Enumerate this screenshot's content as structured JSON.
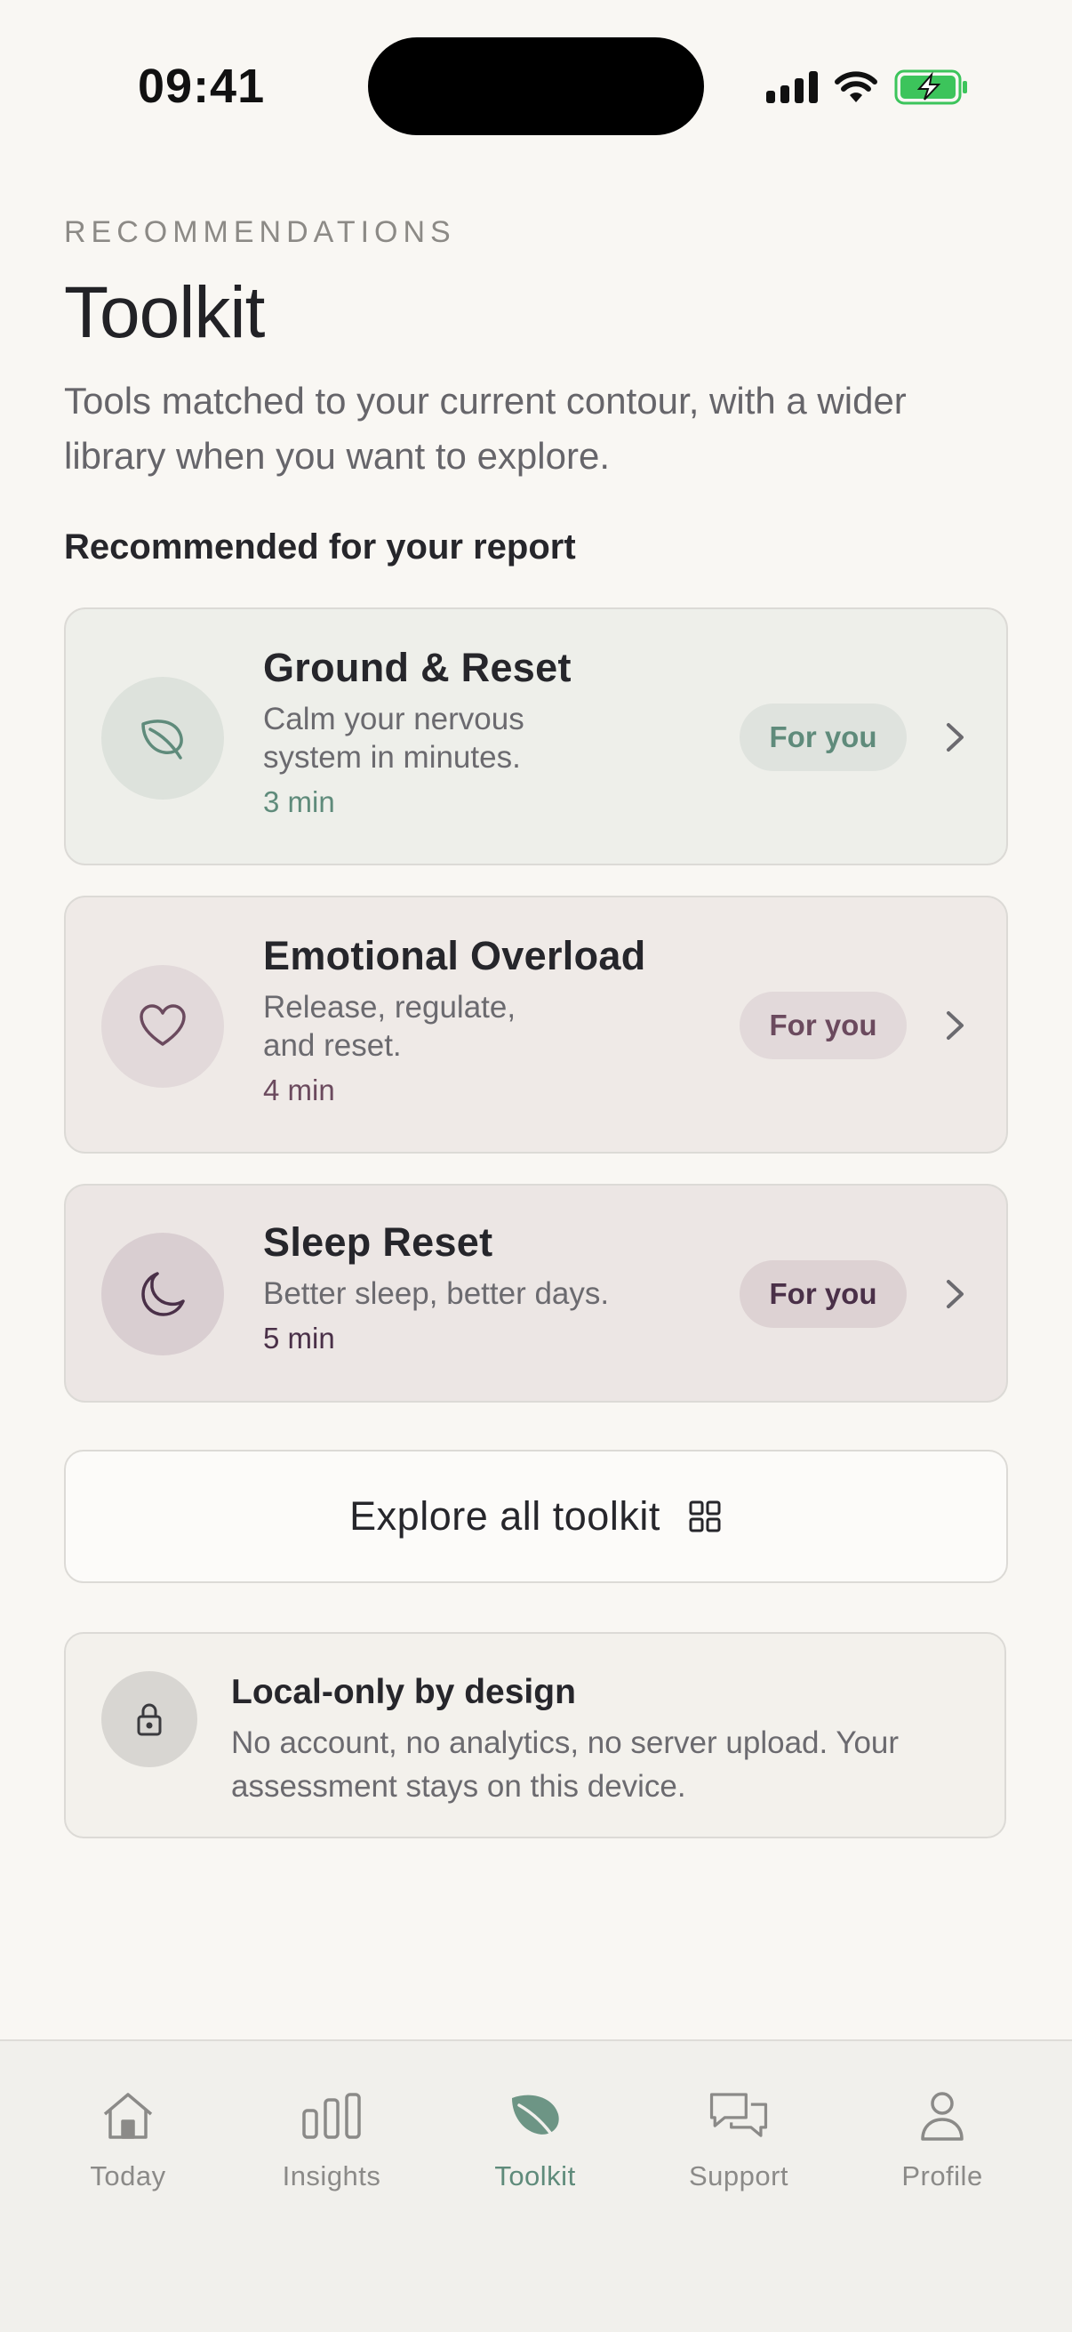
{
  "status_bar": {
    "time": "09:41"
  },
  "header": {
    "eyebrow": "RECOMMENDATIONS",
    "title": "Toolkit",
    "subtitle": "Tools matched to your current contour, with a wider library when you want to explore."
  },
  "section_title": "Recommended for your report",
  "recommendations": [
    {
      "name": "Ground & Reset",
      "description": "Calm your nervous system in minutes.",
      "duration": "3 min",
      "badge": "For you",
      "icon": "leaf-icon",
      "accent": "#5f8b7b"
    },
    {
      "name": "Emotional Overload",
      "description": "Release, regulate, and reset.",
      "duration": "4 min",
      "badge": "For you",
      "icon": "heart-icon",
      "accent": "#6b4a5e"
    },
    {
      "name": "Sleep Reset",
      "description": "Better sleep, better days.",
      "duration": "5 min",
      "badge": "For you",
      "icon": "moon-icon",
      "accent": "#4a3048"
    }
  ],
  "explore": {
    "label": "Explore all toolkit",
    "icon": "grid-icon"
  },
  "privacy": {
    "title": "Local-only by design",
    "body": "No account, no analytics, no server upload. Your assessment stays on this device.",
    "icon": "lock-icon"
  },
  "tabs": [
    {
      "label": "Today",
      "icon": "home-icon",
      "active": false
    },
    {
      "label": "Insights",
      "icon": "bars-icon",
      "active": false
    },
    {
      "label": "Toolkit",
      "icon": "leaf-icon",
      "active": true
    },
    {
      "label": "Support",
      "icon": "chat-icon",
      "active": false
    },
    {
      "label": "Profile",
      "icon": "person-icon",
      "active": false
    }
  ]
}
